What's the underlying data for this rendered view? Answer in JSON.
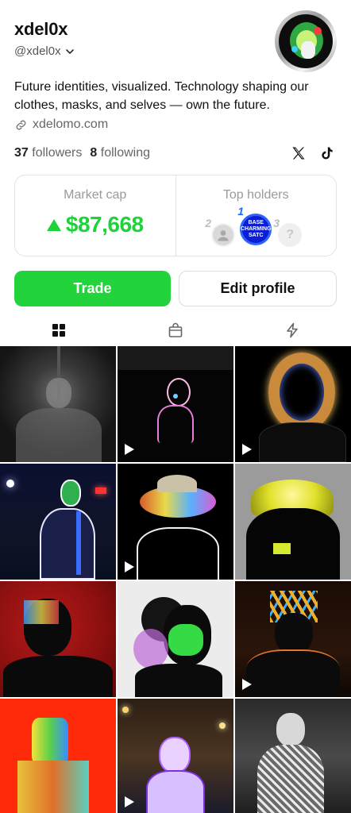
{
  "profile": {
    "name": "xdel0x",
    "handle": "@xdel0x",
    "bio": "Future identities, visualized. Technology shaping our clothes, masks, and selves — own the future.",
    "website": "xdelomo.com",
    "followers_count": "37",
    "followers_label": "followers",
    "following_count": "8",
    "following_label": "following"
  },
  "socials": [
    "x-icon",
    "tiktok-icon"
  ],
  "stats": {
    "market_cap_label": "Market cap",
    "market_cap_value": "$87,668",
    "top_holders_label": "Top holders",
    "holders": [
      {
        "rank": "2"
      },
      {
        "rank": "1",
        "badge_text": "BASE CHARMING SATC"
      },
      {
        "rank": "3",
        "glyph": "?"
      }
    ]
  },
  "actions": {
    "trade_label": "Trade",
    "edit_label": "Edit profile"
  },
  "tabs": [
    "grid-icon",
    "shop-bag-icon",
    "lightning-icon"
  ],
  "colors": {
    "accent_green": "#22d33c",
    "holder_blue": "#0b1fd0"
  },
  "posts": [
    {
      "is_video": false
    },
    {
      "is_video": true
    },
    {
      "is_video": true
    },
    {
      "is_video": false
    },
    {
      "is_video": true
    },
    {
      "is_video": false
    },
    {
      "is_video": false
    },
    {
      "is_video": false
    },
    {
      "is_video": true
    },
    {
      "is_video": false
    },
    {
      "is_video": true
    },
    {
      "is_video": false
    }
  ]
}
